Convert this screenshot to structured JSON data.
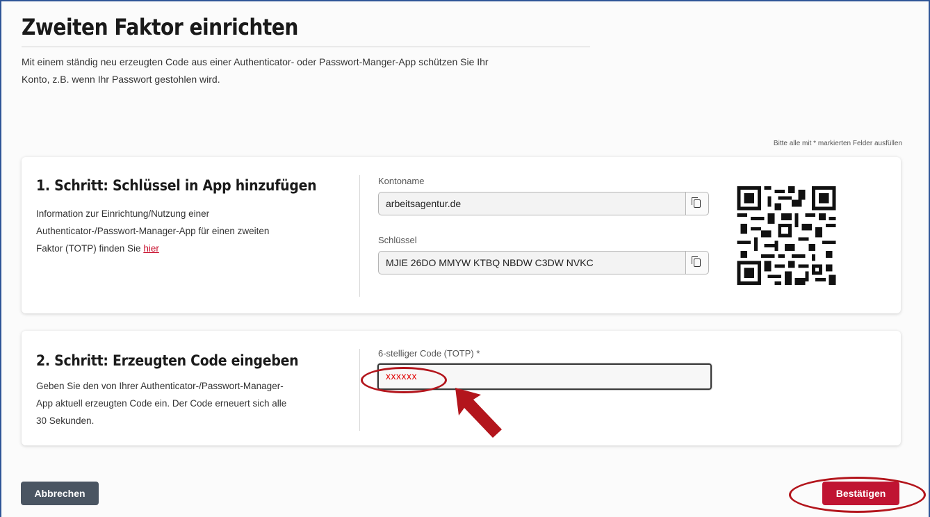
{
  "page": {
    "title": "Zweiten Faktor einrichten",
    "intro_line1": "Mit einem ständig neu erzeugten Code aus einer Authenticator- oder Passwort-Manger-App schützen Sie Ihr",
    "intro_line2": "Konto, z.B. wenn Ihr Passwort gestohlen wird.",
    "required_hint": "Bitte alle mit * markierten Felder ausfüllen"
  },
  "step1": {
    "title": "1. Schritt: Schlüssel in App hinzufügen",
    "text_line1": "Information zur Einrichtung/Nutzung einer",
    "text_line2": "Authenticator-/Passwort-Manager-App für einen zweiten",
    "text_line3_prefix": "Faktor (TOTP) finden Sie ",
    "link_label": "hier",
    "account_label": "Kontoname",
    "account_value": "arbeitsagentur.de",
    "key_label": "Schlüssel",
    "key_value": "MJIE 26DO MMYW KTBQ NBDW C3DW NVKC",
    "copy_icon": "copy-icon",
    "qr_icon": "qr-code"
  },
  "step2": {
    "title": "2. Schritt: Erzeugten Code eingeben",
    "text_line1": "Geben Sie den von Ihrer Authenticator-/Passwort-Manager-",
    "text_line2": "App aktuell erzeugten Code ein. Der Code erneuert sich alle",
    "text_line3": "30 Sekunden.",
    "code_label": "6-stelliger Code (TOTP) *",
    "code_value": "xxxxxx"
  },
  "actions": {
    "cancel_label": "Abbrechen",
    "confirm_label": "Bestätigen"
  },
  "colors": {
    "accent": "#c01432",
    "annotation": "#b3151c",
    "cancel": "#4a5562"
  }
}
